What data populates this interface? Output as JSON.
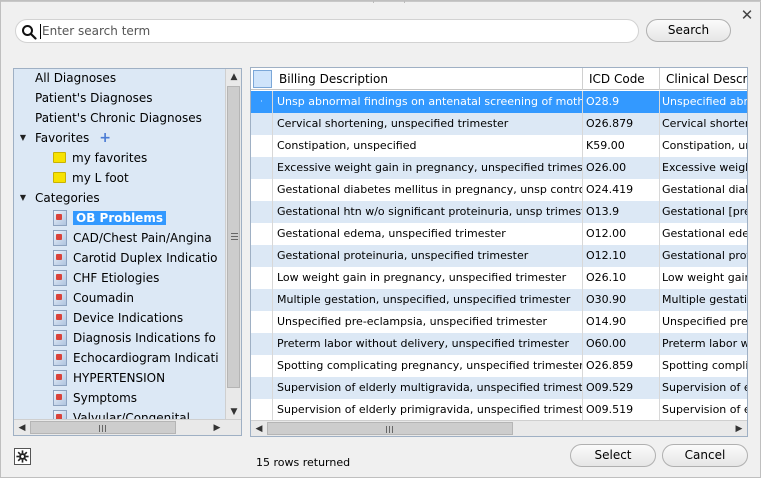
{
  "search": {
    "placeholder": "Enter search term",
    "button_label": "Search"
  },
  "dialog": {
    "close_glyph": "✕"
  },
  "tree": {
    "items": [
      {
        "label": "All Diagnoses",
        "level": 0,
        "kind": "text"
      },
      {
        "label": "Patient's Diagnoses",
        "level": 0,
        "kind": "text"
      },
      {
        "label": "Patient's Chronic Diagnoses",
        "level": 0,
        "kind": "text"
      },
      {
        "label": "Favorites",
        "level": 0,
        "kind": "group",
        "expanded": true,
        "add_icon": "plus-icon"
      },
      {
        "label": "my favorites",
        "level": 1,
        "kind": "folder"
      },
      {
        "label": "my L foot",
        "level": 1,
        "kind": "folder"
      },
      {
        "label": "Categories",
        "level": 0,
        "kind": "group",
        "expanded": true
      },
      {
        "label": "OB Problems",
        "level": 1,
        "kind": "category",
        "selected": true
      },
      {
        "label": "CAD/Chest Pain/Angina",
        "level": 1,
        "kind": "category"
      },
      {
        "label": "Carotid Duplex Indicatio",
        "level": 1,
        "kind": "category"
      },
      {
        "label": "CHF Etiologies",
        "level": 1,
        "kind": "category"
      },
      {
        "label": "Coumadin",
        "level": 1,
        "kind": "category"
      },
      {
        "label": "Device Indications",
        "level": 1,
        "kind": "category"
      },
      {
        "label": "Diagnosis Indications fo",
        "level": 1,
        "kind": "category"
      },
      {
        "label": "Echocardiogram Indicati",
        "level": 1,
        "kind": "category"
      },
      {
        "label": "HYPERTENSION",
        "level": 1,
        "kind": "category"
      },
      {
        "label": "Symptoms",
        "level": 1,
        "kind": "category"
      },
      {
        "label": "Valvular/Congenital",
        "level": 1,
        "kind": "category"
      }
    ]
  },
  "table": {
    "columns": [
      "Billing Description",
      "ICD Code",
      "Clinical Descripti"
    ],
    "rows": [
      [
        "Unsp abnormal findings on antenatal screening of mother",
        "O28.9",
        "Unspecified abno"
      ],
      [
        "Cervical shortening, unspecified trimester",
        "O26.879",
        "Cervical shorteni"
      ],
      [
        "Constipation, unspecified",
        "K59.00",
        "Constipation, un"
      ],
      [
        "Excessive weight gain in pregnancy, unspecified trimester",
        "O26.00",
        "Excessive weight"
      ],
      [
        "Gestational diabetes mellitus in pregnancy, unsp control",
        "O24.419",
        "Gestational diab"
      ],
      [
        "Gestational htn w/o significant proteinuria, unsp trimester",
        "O13.9",
        "Gestational [preg"
      ],
      [
        "Gestational edema, unspecified trimester",
        "O12.00",
        "Gestational eden"
      ],
      [
        "Gestational proteinuria, unspecified trimester",
        "O12.10",
        "Gestational prote"
      ],
      [
        "Low weight gain in pregnancy, unspecified trimester",
        "O26.10",
        "Low weight gain"
      ],
      [
        "Multiple gestation, unspecified, unspecified trimester",
        "O30.90",
        "Multiple gestatio"
      ],
      [
        "Unspecified pre-eclampsia, unspecified trimester",
        "O14.90",
        "Unspecified pre-"
      ],
      [
        "Preterm labor without delivery, unspecified trimester",
        "O60.00",
        "Preterm labor wi"
      ],
      [
        "Spotting complicating pregnancy, unspecified trimester",
        "O26.859",
        "Spotting complic"
      ],
      [
        "Supervision of elderly multigravida, unspecified trimester",
        "O09.529",
        "Supervision of el"
      ],
      [
        "Supervision of elderly primigravida, unspecified trimester",
        "O09.519",
        "Supervision of el"
      ]
    ],
    "selected_row": 0,
    "row_marker": "·"
  },
  "footer": {
    "status": "15 rows returned",
    "select_label": "Select",
    "cancel_label": "Cancel",
    "settings_icon": "gear-icon"
  },
  "colors": {
    "selection": "#3399ff",
    "alt_row": "#dce8f5",
    "tree_bg": "#dce8f5"
  }
}
